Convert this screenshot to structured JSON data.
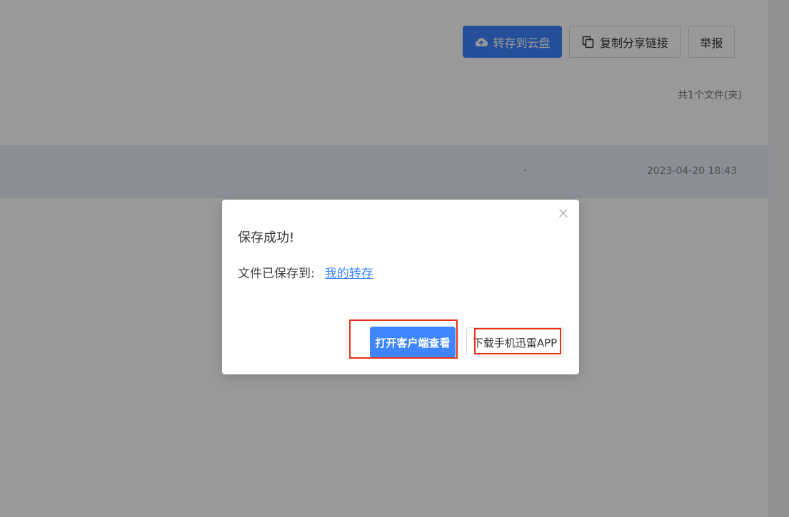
{
  "toolbar": {
    "save_label": "转存到云盘",
    "copy_label": "复制分享链接",
    "report_label": "举报"
  },
  "file_list": {
    "count_text": "共1个文件(夹)",
    "rows": [
      {
        "size": "-",
        "time": "2023-04-20 18:43"
      }
    ]
  },
  "dialog": {
    "title": "保存成功!",
    "saved_to_label": "文件已保存到:",
    "saved_to_link": "我的转存",
    "open_client_label": "打开客户端查看",
    "download_app_label": "下载手机迅雷APP"
  },
  "colors": {
    "primary": "#3f85ff",
    "highlight": "#e8311a"
  },
  "icons": {
    "save": "cloud-upload-icon",
    "copy": "copy-icon",
    "close": "close-icon"
  }
}
